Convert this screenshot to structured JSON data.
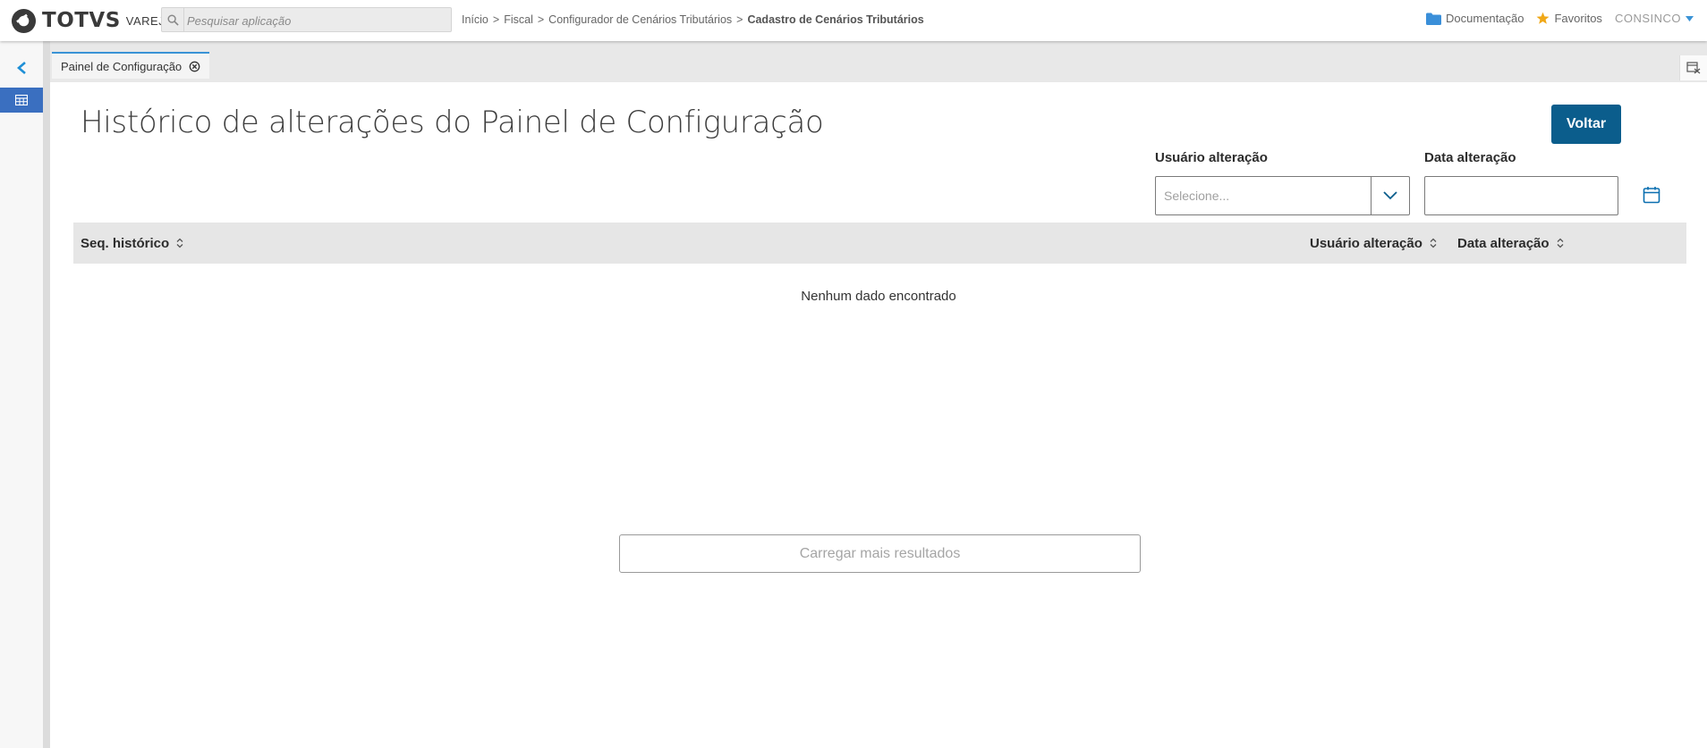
{
  "header": {
    "logo_text": "TOTVS",
    "logo_sub": "VAREJO",
    "search_placeholder": "Pesquisar aplicação",
    "breadcrumb": [
      "Início",
      "Fiscal",
      "Configurador de Cenários Tributários",
      "Cadastro de Cenários Tributários"
    ],
    "breadcrumb_sep": ">",
    "documentacao": "Documentação",
    "favoritos": "Favoritos",
    "user": "CONSINCO"
  },
  "tabs": [
    {
      "label": "Painel de Configuração",
      "active": true
    }
  ],
  "page": {
    "title": "Histórico de alterações do Painel de Configuração",
    "back_button": "Voltar",
    "filters": {
      "usuario_label": "Usuário alteração",
      "usuario_placeholder": "Selecione...",
      "data_label": "Data alteração",
      "data_value": ""
    },
    "table": {
      "columns": [
        "Seq. histórico",
        "Usuário alteração",
        "Data alteração"
      ],
      "rows": [],
      "empty_text": "Nenhum dado encontrado"
    },
    "load_more": "Carregar mais resultados"
  },
  "colors": {
    "primary": "#0b5d8c",
    "accent": "#3a93d6",
    "rail_active": "#3a6fc0",
    "folder": "#3a8fd9",
    "star": "#f0a818"
  },
  "icons": {
    "search": "magnifier",
    "back": "chevron-left",
    "app": "table-grid",
    "close_tab": "circle-x",
    "calendar": "calendar",
    "sort": "up-down-chevrons"
  }
}
